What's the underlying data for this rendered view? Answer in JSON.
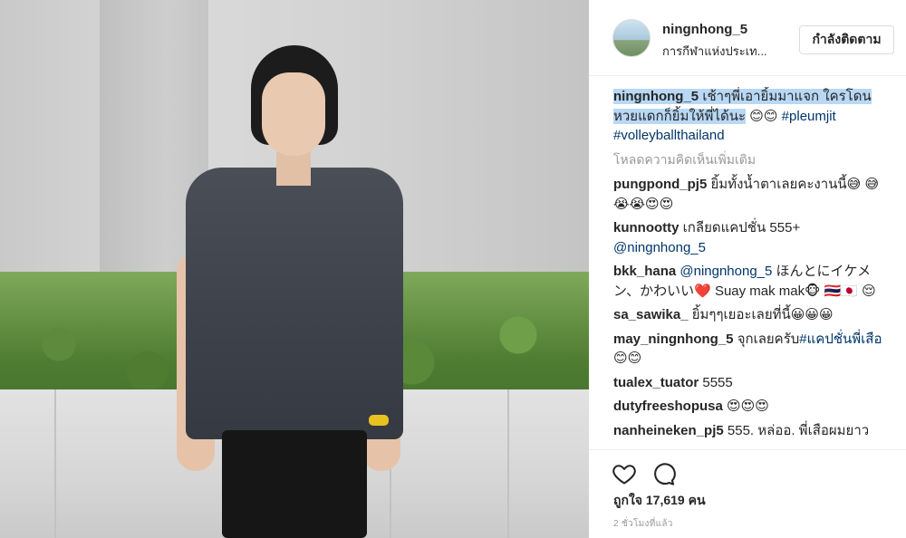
{
  "post": {
    "image_alt": "woman in denim shirt",
    "username": "ningnhong_5",
    "location": "การกีฬาแห่งประเท...",
    "follow_label": "กำลังติดตาม",
    "caption": {
      "username": "ningnhong_5",
      "text_highlighted": "เช้าๆพี่เอายิ้มมาแจก ใครโดน หวยแดกก็ยิ้มให้พี่ได้นะ",
      "emoji": "😊😊",
      "hashtag1": "#pleumjit",
      "hashtag2": "#volleyballthailand"
    },
    "load_more": "โหลดความคิดเห็นเพิ่มเติม",
    "comments": [
      {
        "user": "pungpond_pj5",
        "text": "ยิ้มทั้งน้ำตาเลยคะงานนี้😅 😅 😭😭😍😍"
      },
      {
        "user": "kunnootty",
        "text": "เกลียดแคปชั่น 555+",
        "mention": "@ningnhong_5"
      },
      {
        "user": "bkk_hana",
        "mention": "@ningnhong_5",
        "text": "ほんとにイケメン、かわいい❤️ Suay mak mak🐵 🇹🇭🇯🇵 😌"
      },
      {
        "user": "sa_sawika_",
        "text": "ยิ้มๆๆเยอะเลยที่นี้😀😀😀"
      },
      {
        "user": "may_ningnhong_5",
        "text": "จุกเลยครับ",
        "hashtag": "#แคปชั่นพี่เสือ",
        "emoji": "😊😊"
      },
      {
        "user": "tualex_tuator",
        "text": "5555"
      },
      {
        "user": "dutyfreeshopusa",
        "text": "😍😍😍"
      },
      {
        "user": "nanheineken_pj5",
        "text": "555. หล่ออ. พี่เสือผมยาว"
      }
    ],
    "likes_label": "ถูกใจ 17,619 คน",
    "time_label": "2 ชั่วโมงที่แล้ว",
    "icons": {
      "like": "heart-icon",
      "comment": "comment-bubble-icon"
    },
    "colors": {
      "highlight": "#b8d8f5",
      "link": "#003569",
      "muted": "#999999"
    }
  }
}
